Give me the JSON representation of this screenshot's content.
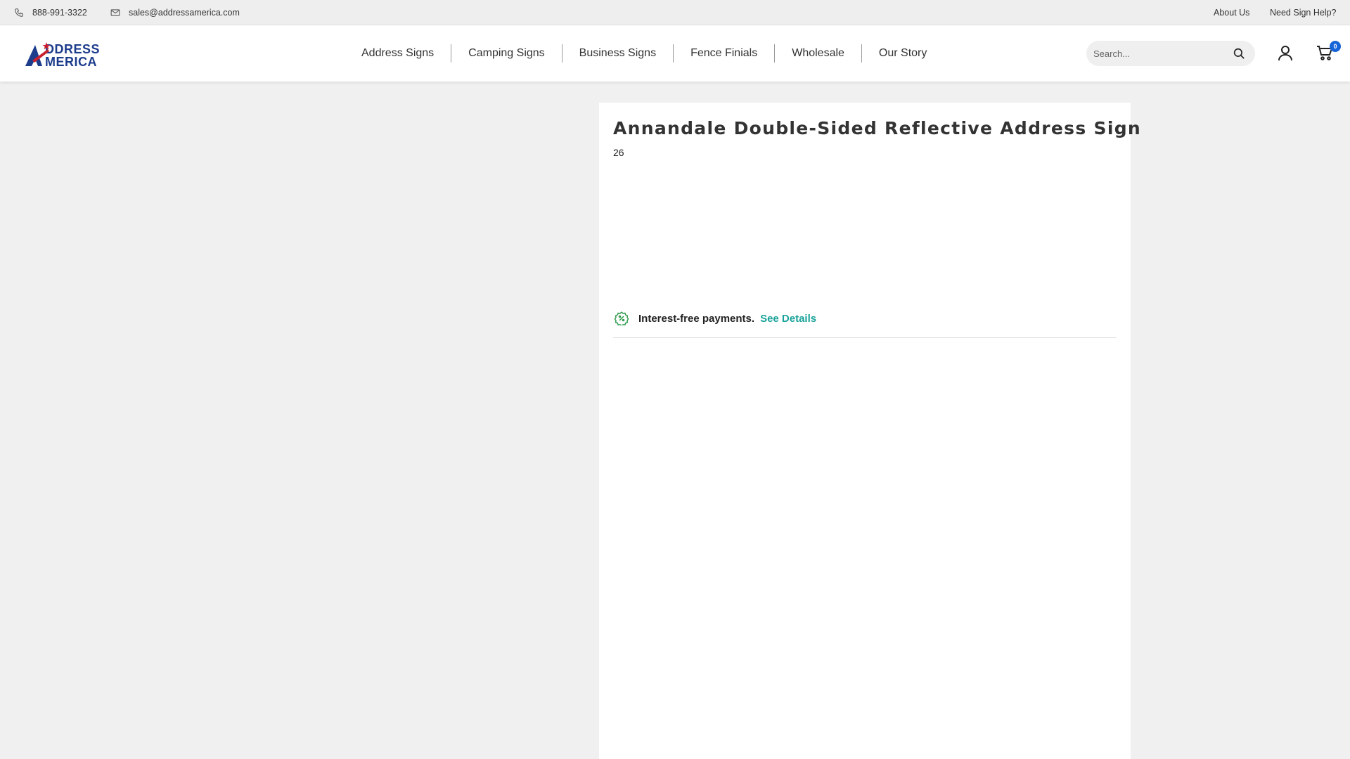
{
  "topbar": {
    "phone": "888-991-3322",
    "email": "sales@addressamerica.com",
    "links": [
      "About Us",
      "Need Sign Help?"
    ]
  },
  "header": {
    "logo_text": "ADDRESS AMERICA",
    "nav": [
      "Address Signs",
      "Camping Signs",
      "Business Signs",
      "Fence Finials",
      "Wholesale",
      "Our Story"
    ],
    "search_placeholder": "Search...",
    "cart_count": "0"
  },
  "product": {
    "title": "Annandale Double-Sided Reflective Address Sign",
    "subtext": "26",
    "payments_text": "Interest-free payments.",
    "see_details": "See Details"
  },
  "colors": {
    "brand_blue": "#1c3c8c",
    "brand_red": "#c8202f",
    "link_teal": "#1aa39a",
    "badge_blue": "#1565d8"
  }
}
